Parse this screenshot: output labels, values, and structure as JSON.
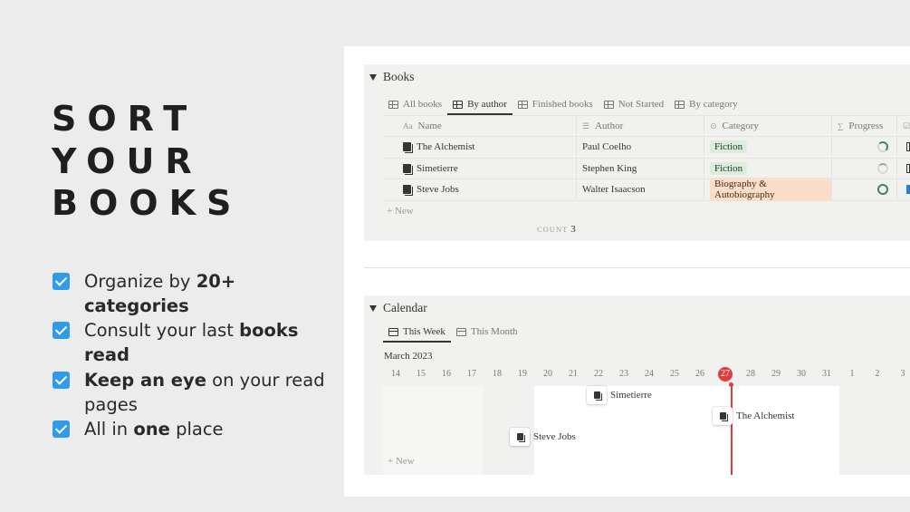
{
  "hero": {
    "lines": [
      "SORT",
      "YOUR",
      "BOOKS"
    ]
  },
  "features": [
    {
      "pre": "Organize by ",
      "bold": "20+ categories",
      "post": ""
    },
    {
      "pre": "Consult your last ",
      "bold": "books read",
      "post": ""
    },
    {
      "pre": "",
      "bold": "Keep an eye",
      "post": " on your read pages"
    },
    {
      "pre": "All in ",
      "bold": "one",
      "post": " place"
    }
  ],
  "books_db": {
    "title": "Books",
    "tabs": [
      "All books",
      "By author",
      "Finished books",
      "Not Started",
      "By category"
    ],
    "active_tab": 1,
    "columns": {
      "name": "Name",
      "author": "Author",
      "category": "Category",
      "progress": "Progress"
    },
    "rows": [
      {
        "name": "The Alchemist",
        "author": "Paul Coelho",
        "category": "Fiction",
        "tag_color": "green",
        "progress": "partial",
        "done": false
      },
      {
        "name": "Simetierre",
        "author": "Stephen King",
        "category": "Fiction",
        "tag_color": "green",
        "progress": "low",
        "done": false
      },
      {
        "name": "Steve Jobs",
        "author": "Walter Isaacson",
        "category": "Biography & Autobiography",
        "tag_color": "orange",
        "progress": "complete",
        "done": true
      }
    ],
    "new_label": "+ New",
    "count_label": "COUNT",
    "count_value": "3"
  },
  "calendar": {
    "title": "Calendar",
    "tabs": [
      "This Week",
      "This Month"
    ],
    "active_tab": 0,
    "month": "March 2023",
    "days": [
      "14",
      "15",
      "16",
      "17",
      "18",
      "19",
      "20",
      "21",
      "22",
      "23",
      "24",
      "25",
      "26",
      "27",
      "28",
      "29",
      "30",
      "31",
      "1",
      "2",
      "3"
    ],
    "today": "27",
    "events": [
      "Simetierre",
      "The Alchemist",
      "Steve Jobs"
    ],
    "new_label": "+ New"
  }
}
